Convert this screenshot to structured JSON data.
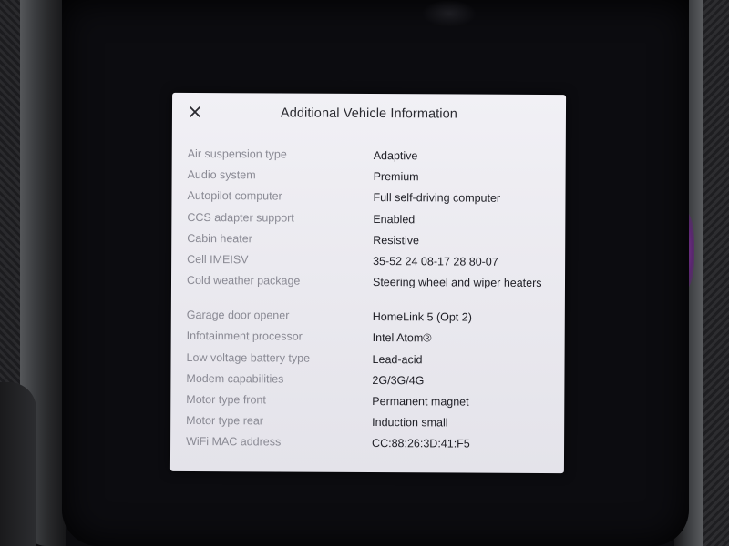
{
  "dialog": {
    "title": "Additional Vehicle Information",
    "close_icon": "close-icon"
  },
  "rows": [
    {
      "key": "Air suspension type",
      "value": "Adaptive"
    },
    {
      "key": "Audio system",
      "value": "Premium"
    },
    {
      "key": "Autopilot computer",
      "value": "Full self-driving computer"
    },
    {
      "key": "CCS adapter support",
      "value": "Enabled"
    },
    {
      "key": "Cabin heater",
      "value": "Resistive"
    },
    {
      "key": "Cell IMEISV",
      "value": "35-52 24 08-17 28 80-07"
    },
    {
      "key": "Cold weather package",
      "value": "Steering wheel and wiper heaters"
    },
    {
      "key": "Garage door opener",
      "value": "HomeLink 5 (Opt 2)"
    },
    {
      "key": "Infotainment processor",
      "value": "Intel Atom®"
    },
    {
      "key": "Low voltage battery type",
      "value": "Lead-acid"
    },
    {
      "key": "Modem capabilities",
      "value": "2G/3G/4G"
    },
    {
      "key": "Motor type front",
      "value": "Permanent magnet"
    },
    {
      "key": "Motor type rear",
      "value": "Induction small"
    },
    {
      "key": "WiFi MAC address",
      "value": "CC:88:26:3D:41:F5"
    }
  ]
}
